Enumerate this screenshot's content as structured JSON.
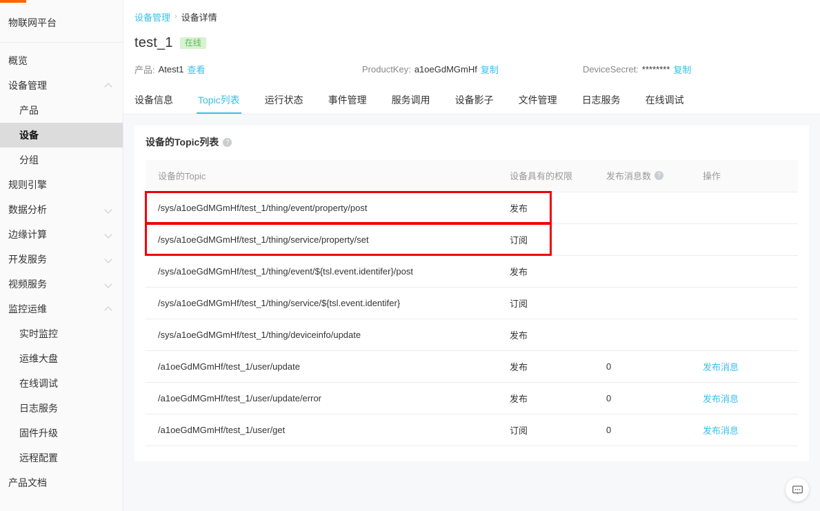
{
  "brand": {
    "name": "物联网平台"
  },
  "sidebar": {
    "items": [
      {
        "label": "概览",
        "level": 1,
        "chevron": "none",
        "active": false
      },
      {
        "label": "设备管理",
        "level": 1,
        "chevron": "up",
        "active": false
      },
      {
        "label": "产品",
        "level": 2,
        "chevron": "none",
        "active": false
      },
      {
        "label": "设备",
        "level": 2,
        "chevron": "none",
        "active": true
      },
      {
        "label": "分组",
        "level": 2,
        "chevron": "none",
        "active": false
      },
      {
        "label": "规则引擎",
        "level": 1,
        "chevron": "none",
        "active": false
      },
      {
        "label": "数据分析",
        "level": 1,
        "chevron": "down",
        "active": false
      },
      {
        "label": "边缘计算",
        "level": 1,
        "chevron": "down",
        "active": false
      },
      {
        "label": "开发服务",
        "level": 1,
        "chevron": "down",
        "active": false
      },
      {
        "label": "视频服务",
        "level": 1,
        "chevron": "down",
        "active": false
      },
      {
        "label": "监控运维",
        "level": 1,
        "chevron": "up",
        "active": false
      },
      {
        "label": "实时监控",
        "level": 2,
        "chevron": "none",
        "active": false
      },
      {
        "label": "运维大盘",
        "level": 2,
        "chevron": "none",
        "active": false
      },
      {
        "label": "在线调试",
        "level": 2,
        "chevron": "none",
        "active": false
      },
      {
        "label": "日志服务",
        "level": 2,
        "chevron": "none",
        "active": false
      },
      {
        "label": "固件升级",
        "level": 2,
        "chevron": "none",
        "active": false
      },
      {
        "label": "远程配置",
        "level": 2,
        "chevron": "none",
        "active": false
      },
      {
        "label": "产品文档",
        "level": 1,
        "chevron": "none",
        "active": false
      }
    ]
  },
  "breadcrumb": {
    "parent": "设备管理",
    "separator": "›",
    "current": "设备详情"
  },
  "device": {
    "name": "test_1",
    "status": "在线",
    "product_label": "产品:",
    "product_value": "Atest1",
    "product_link": "查看",
    "productkey_label": "ProductKey:",
    "productkey_value": "a1oeGdMGmHf",
    "productkey_copy": "复制",
    "devicesecret_label": "DeviceSecret:",
    "devicesecret_value": "********",
    "devicesecret_copy": "复制"
  },
  "tabs": [
    {
      "label": "设备信息",
      "active": false
    },
    {
      "label": "Topic列表",
      "active": true
    },
    {
      "label": "运行状态",
      "active": false
    },
    {
      "label": "事件管理",
      "active": false
    },
    {
      "label": "服务调用",
      "active": false
    },
    {
      "label": "设备影子",
      "active": false
    },
    {
      "label": "文件管理",
      "active": false
    },
    {
      "label": "日志服务",
      "active": false
    },
    {
      "label": "在线调试",
      "active": false
    }
  ],
  "panel": {
    "title": "设备的Topic列表",
    "title_help": "?",
    "columns": [
      {
        "label": "设备的Topic",
        "help": false
      },
      {
        "label": "设备具有的权限",
        "help": false
      },
      {
        "label": "发布消息数",
        "help": true
      },
      {
        "label": "操作",
        "help": false
      }
    ],
    "help_glyph": "?",
    "rows": [
      {
        "topic": "/sys/a1oeGdMGmHf/test_1/thing/event/property/post",
        "permission": "发布",
        "count": "",
        "action": "",
        "highlighted": true
      },
      {
        "topic": "/sys/a1oeGdMGmHf/test_1/thing/service/property/set",
        "permission": "订阅",
        "count": "",
        "action": "",
        "highlighted": true
      },
      {
        "topic": "/sys/a1oeGdMGmHf/test_1/thing/event/${tsl.event.identifer}/post",
        "permission": "发布",
        "count": "",
        "action": "",
        "highlighted": false
      },
      {
        "topic": "/sys/a1oeGdMGmHf/test_1/thing/service/${tsl.event.identifer}",
        "permission": "订阅",
        "count": "",
        "action": "",
        "highlighted": false
      },
      {
        "topic": "/sys/a1oeGdMGmHf/test_1/thing/deviceinfo/update",
        "permission": "发布",
        "count": "",
        "action": "",
        "highlighted": false
      },
      {
        "topic": "/a1oeGdMGmHf/test_1/user/update",
        "permission": "发布",
        "count": "0",
        "action": "发布消息",
        "highlighted": false
      },
      {
        "topic": "/a1oeGdMGmHf/test_1/user/update/error",
        "permission": "发布",
        "count": "0",
        "action": "发布消息",
        "highlighted": false
      },
      {
        "topic": "/a1oeGdMGmHf/test_1/user/get",
        "permission": "订阅",
        "count": "0",
        "action": "发布消息",
        "highlighted": false
      }
    ]
  },
  "colors": {
    "accent": "#38c0e8",
    "progress": "#ff6600",
    "online_text": "#5cb85c",
    "online_bg": "#d9f2d0",
    "highlight": "#ee0000",
    "sidebar_active_bg": "#dcdcdc"
  },
  "chat": {
    "icon": "chat-bubble-icon"
  }
}
